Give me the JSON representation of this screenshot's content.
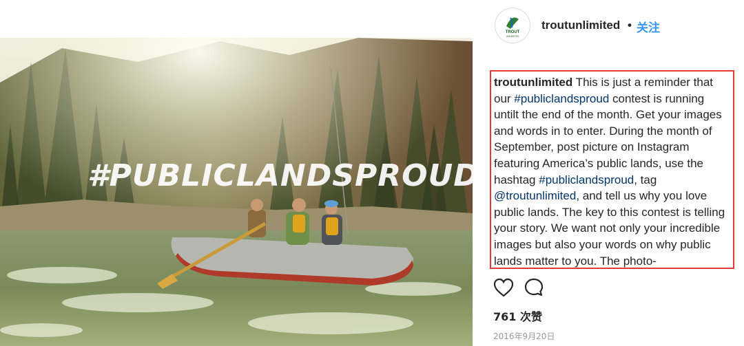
{
  "post": {
    "username": "troutunlimited",
    "separator": "•",
    "follow_label": "关注",
    "image_overlay_text": "#PUBLICLANDSPROUD",
    "avatar_logo_text": "TROUT",
    "avatar_logo_subtext": "UNLIMITED"
  },
  "caption": {
    "user": "troutunlimited",
    "t1": " This is just a reminder that our ",
    "tag1": "#publiclandsproud",
    "t2": " contest is running untilt the end of the month. Get your images and words in to enter. During the month of September, post picture on Instagram featuring America’s public lands, use the hashtag ",
    "tag2": "#publiclandsproud",
    "t3": ", tag ",
    "tag3": "@troutunlimited",
    "t4": ", and tell us why you love public lands. The key to this contest is telling your story. We want not only your incredible images but also your words on why public lands matter to you. The photo-"
  },
  "actions": {
    "like_icon": "heart-icon",
    "comment_icon": "comment-icon"
  },
  "likes": "761 次赞",
  "date": "2016年9月20日",
  "colors": {
    "highlight_border": "#e53935",
    "link": "#003569",
    "follow": "#3897f0"
  }
}
